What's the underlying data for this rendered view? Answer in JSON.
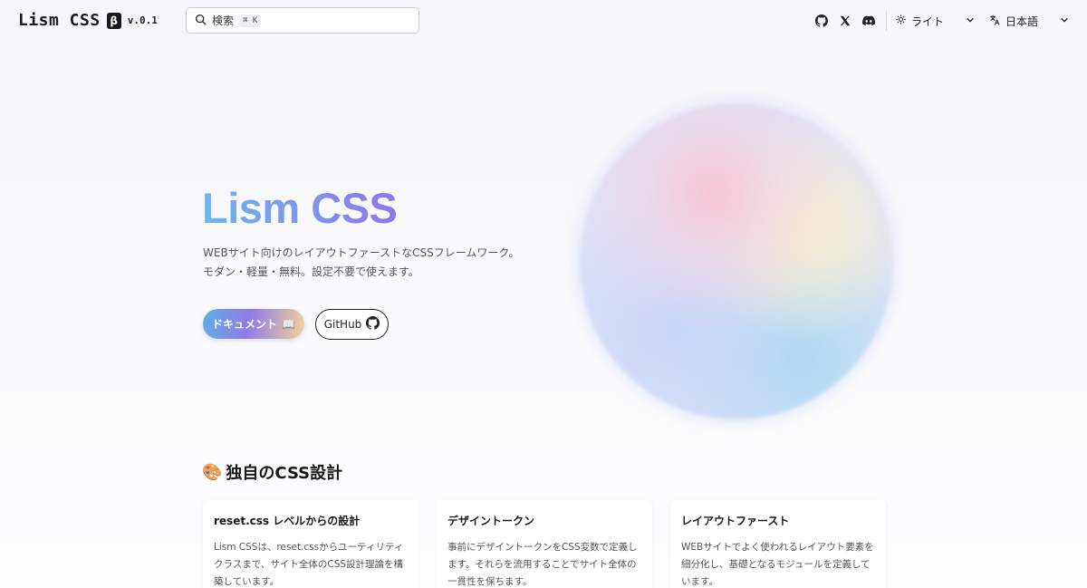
{
  "header": {
    "logo_text": "Lism CSS",
    "beta_badge": "β",
    "version": "v.0.1",
    "search_placeholder": "検索",
    "search_shortcut": "⌘ K",
    "icons": [
      "github-icon",
      "x-icon",
      "discord-icon"
    ],
    "theme_select": "ライト",
    "language_select": "日本語"
  },
  "hero": {
    "title": "Lism CSS",
    "desc_line1": "WEBサイト向けのレイアウトファーストなCSSフレームワーク。",
    "desc_line2": "モダン・軽量・無料。設定不要で使えます。",
    "docs_button": "ドキュメント",
    "docs_button_emoji": "📖",
    "github_button": "GitHub"
  },
  "section": {
    "emoji": "🎨",
    "title": "独自のCSS設計",
    "cards": [
      {
        "title": "reset.css レベルからの設計",
        "body": "Lism CSSは、reset.cssからユーティリティクラスまで、サイト全体のCSS設計理論を構築しています。"
      },
      {
        "title": "デザイントークン",
        "body": "事前にデザイントークンをCSS変数で定義します。それらを流用することでサイト全体の一貫性を保ちます。"
      },
      {
        "title": "レイアウトファースト",
        "body": "WEBサイトでよく使われるレイアウト要素を細分化し、基礎となるモジュールを定義しています。"
      }
    ]
  },
  "colors": {
    "title_gradient_start": "#6cb7ec",
    "title_gradient_end": "#8f77e8",
    "text": "#222222"
  }
}
